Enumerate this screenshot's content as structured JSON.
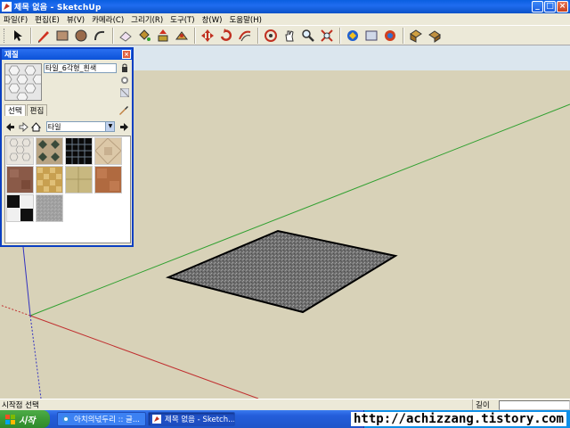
{
  "window": {
    "title": "제목 없음 - SketchUp",
    "minimize": "_",
    "maximize": "□",
    "close": "×"
  },
  "menu": [
    "파일(F)",
    "편집(E)",
    "뷰(V)",
    "카메라(C)",
    "그리기(R)",
    "도구(T)",
    "창(W)",
    "도움말(H)"
  ],
  "toolbar": {
    "tools": [
      "select-icon",
      "pencil-icon",
      "rectangle-icon",
      "circle-icon",
      "arc-icon",
      "eraser-icon",
      "paint-bucket-icon",
      "push-pull-icon",
      "follow-me-icon",
      "move-icon",
      "rotate-icon",
      "offset-icon",
      "orbit-icon",
      "pan-icon",
      "zoom-icon",
      "zoom-extents-icon",
      "get-models-icon",
      "share-model-icon",
      "google-earth-icon",
      "components-icon",
      "photo-textures-icon"
    ]
  },
  "materials": {
    "title": "재질",
    "close": "×",
    "current_name": "타일_6각형_흰색",
    "tabs": [
      "선택",
      "편집"
    ],
    "selected_tab": "선택",
    "library": "타일",
    "swatches": [
      {
        "name": "hexagon-white-tile",
        "color": "#e8e4dc"
      },
      {
        "name": "diamond-brown-tile",
        "color": "#b8a484"
      },
      {
        "name": "black-grid-tile",
        "color": "#0a0a0a"
      },
      {
        "name": "beige-stone-tile",
        "color": "#dcc8a8"
      },
      {
        "name": "red-stone-tile",
        "color": "#8a5a48"
      },
      {
        "name": "ochre-mosaic-tile",
        "color": "#c8a050"
      },
      {
        "name": "sandstone-tile",
        "color": "#c8b880"
      },
      {
        "name": "terracotta-tile",
        "color": "#b06a40"
      },
      {
        "name": "checker-black-white-tile",
        "color": "#202020"
      },
      {
        "name": "gray-granite-tile",
        "color": "#bcbcbc"
      }
    ]
  },
  "scene": {
    "background": "#d8d2b8",
    "sky": "#dbe6ee",
    "face_color": "#727272",
    "axis_colors": {
      "red": "#c03030",
      "green": "#30a030",
      "blue": "#3030c0"
    }
  },
  "status": {
    "message": "시작점 선택",
    "measurement_label": "길이"
  },
  "taskbar": {
    "start": "시작",
    "items": [
      {
        "label": "아치의넋두리 :: 글...",
        "active": false
      },
      {
        "label": "제목 없음 - Sketch...",
        "active": true
      }
    ],
    "watermark": "http://achizzang.tistory.com"
  }
}
